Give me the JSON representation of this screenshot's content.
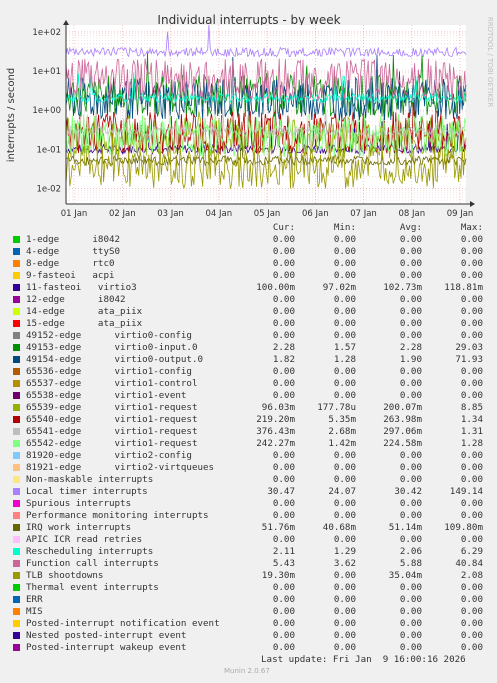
{
  "title": "Individual interrupts - by week",
  "watermark": "RRDTOOL / TOBI OETIKER",
  "footer": "Munin 2.0.67",
  "last_update": "Last update: Fri Jan  9 16:00:16 2026",
  "columns": [
    "Cur:",
    "Min:",
    "Avg:",
    "Max:"
  ],
  "chart_data": {
    "type": "line",
    "title": "Individual interrupts - by week",
    "ylabel": "interrupts / second",
    "yscale": "log",
    "ylim": [
      0.004,
      150
    ],
    "yticks": [
      "1e-02",
      "1e-01",
      "1e+00",
      "1e+01",
      "1e+02"
    ],
    "xticks": [
      "01 Jan",
      "02 Jan",
      "03 Jan",
      "04 Jan",
      "05 Jan",
      "06 Jan",
      "07 Jan",
      "08 Jan",
      "09 Jan"
    ],
    "grid": true,
    "series": [
      {
        "name": "1-edge      i8042",
        "color": "#00cc00",
        "cur": "0.00",
        "min": "0.00",
        "avg": "0.00",
        "max": "0.00"
      },
      {
        "name": "4-edge      ttyS0",
        "color": "#0066b3",
        "cur": "0.00",
        "min": "0.00",
        "avg": "0.00",
        "max": "0.00"
      },
      {
        "name": "8-edge      rtc0",
        "color": "#ff8000",
        "cur": "0.00",
        "min": "0.00",
        "avg": "0.00",
        "max": "0.00"
      },
      {
        "name": "9-fasteoi   acpi",
        "color": "#ffcc00",
        "cur": "0.00",
        "min": "0.00",
        "avg": "0.00",
        "max": "0.00"
      },
      {
        "name": "11-fasteoi   virtio3",
        "color": "#330099",
        "cur": "100.00m",
        "min": "97.02m",
        "avg": "102.73m",
        "max": "118.81m"
      },
      {
        "name": "12-edge      i8042",
        "color": "#990099",
        "cur": "0.00",
        "min": "0.00",
        "avg": "0.00",
        "max": "0.00"
      },
      {
        "name": "14-edge      ata_piix",
        "color": "#ccff00",
        "cur": "0.00",
        "min": "0.00",
        "avg": "0.00",
        "max": "0.00"
      },
      {
        "name": "15-edge      ata_piix",
        "color": "#ff0000",
        "cur": "0.00",
        "min": "0.00",
        "avg": "0.00",
        "max": "0.00"
      },
      {
        "name": "49152-edge      virtio0-config",
        "color": "#808080",
        "cur": "0.00",
        "min": "0.00",
        "avg": "0.00",
        "max": "0.00"
      },
      {
        "name": "49153-edge      virtio0-input.0",
        "color": "#008f00",
        "cur": "2.28",
        "min": "1.57",
        "avg": "2.28",
        "max": "29.03"
      },
      {
        "name": "49154-edge      virtio0-output.0",
        "color": "#00487d",
        "cur": "1.82",
        "min": "1.28",
        "avg": "1.90",
        "max": "71.93"
      },
      {
        "name": "65536-edge      virtio1-config",
        "color": "#b35a00",
        "cur": "0.00",
        "min": "0.00",
        "avg": "0.00",
        "max": "0.00"
      },
      {
        "name": "65537-edge      virtio1-control",
        "color": "#b38f00",
        "cur": "0.00",
        "min": "0.00",
        "avg": "0.00",
        "max": "0.00"
      },
      {
        "name": "65538-edge      virtio1-event",
        "color": "#6b006b",
        "cur": "0.00",
        "min": "0.00",
        "avg": "0.00",
        "max": "0.00"
      },
      {
        "name": "65539-edge      virtio1-request",
        "color": "#8fb300",
        "cur": "96.03m",
        "min": "177.78u",
        "avg": "200.07m",
        "max": "8.85"
      },
      {
        "name": "65540-edge      virtio1-request",
        "color": "#b30000",
        "cur": "219.20m",
        "min": "5.35m",
        "avg": "263.98m",
        "max": "1.34"
      },
      {
        "name": "65541-edge      virtio1-request",
        "color": "#bebebe",
        "cur": "376.43m",
        "min": "2.68m",
        "avg": "297.06m",
        "max": "1.31"
      },
      {
        "name": "65542-edge      virtio1-request",
        "color": "#80ff80",
        "cur": "242.27m",
        "min": "1.42m",
        "avg": "224.58m",
        "max": "1.28"
      },
      {
        "name": "81920-edge      virtio2-config",
        "color": "#80c9ff",
        "cur": "0.00",
        "min": "0.00",
        "avg": "0.00",
        "max": "0.00"
      },
      {
        "name": "81921-edge      virtio2-virtqueues",
        "color": "#ffc080",
        "cur": "0.00",
        "min": "0.00",
        "avg": "0.00",
        "max": "0.00"
      },
      {
        "name": "Non-maskable interrupts",
        "color": "#ffe680",
        "cur": "0.00",
        "min": "0.00",
        "avg": "0.00",
        "max": "0.00"
      },
      {
        "name": "Local timer interrupts",
        "color": "#aa80ff",
        "cur": "30.47",
        "min": "24.07",
        "avg": "30.42",
        "max": "149.14"
      },
      {
        "name": "Spurious interrupts",
        "color": "#ee00cc",
        "cur": "0.00",
        "min": "0.00",
        "avg": "0.00",
        "max": "0.00"
      },
      {
        "name": "Performance monitoring interrupts",
        "color": "#ff8080",
        "cur": "0.00",
        "min": "0.00",
        "avg": "0.00",
        "max": "0.00"
      },
      {
        "name": "IRQ work interrupts",
        "color": "#666600",
        "cur": "51.76m",
        "min": "40.68m",
        "avg": "51.14m",
        "max": "109.80m"
      },
      {
        "name": "APIC ICR read retries",
        "color": "#ffbfff",
        "cur": "0.00",
        "min": "0.00",
        "avg": "0.00",
        "max": "0.00"
      },
      {
        "name": "Rescheduling interrupts",
        "color": "#00ffcc",
        "cur": "2.11",
        "min": "1.29",
        "avg": "2.06",
        "max": "6.29"
      },
      {
        "name": "Function call interrupts",
        "color": "#cc6699",
        "cur": "5.43",
        "min": "3.62",
        "avg": "5.88",
        "max": "40.84"
      },
      {
        "name": "TLB shootdowns",
        "color": "#999900",
        "cur": "19.30m",
        "min": "0.00",
        "avg": "35.04m",
        "max": "2.08"
      },
      {
        "name": "Thermal event interrupts",
        "color": "#00cc00",
        "cur": "0.00",
        "min": "0.00",
        "avg": "0.00",
        "max": "0.00"
      },
      {
        "name": "ERR",
        "color": "#0066b3",
        "cur": "0.00",
        "min": "0.00",
        "avg": "0.00",
        "max": "0.00"
      },
      {
        "name": "MIS",
        "color": "#ff8000",
        "cur": "0.00",
        "min": "0.00",
        "avg": "0.00",
        "max": "0.00"
      },
      {
        "name": "Posted-interrupt notification event",
        "color": "#ffcc00",
        "cur": "0.00",
        "min": "0.00",
        "avg": "0.00",
        "max": "0.00"
      },
      {
        "name": "Nested posted-interrupt event",
        "color": "#330099",
        "cur": "0.00",
        "min": "0.00",
        "avg": "0.00",
        "max": "0.00"
      },
      {
        "name": "Posted-interrupt wakeup event",
        "color": "#990099",
        "cur": "0.00",
        "min": "0.00",
        "avg": "0.00",
        "max": "0.00"
      }
    ]
  }
}
